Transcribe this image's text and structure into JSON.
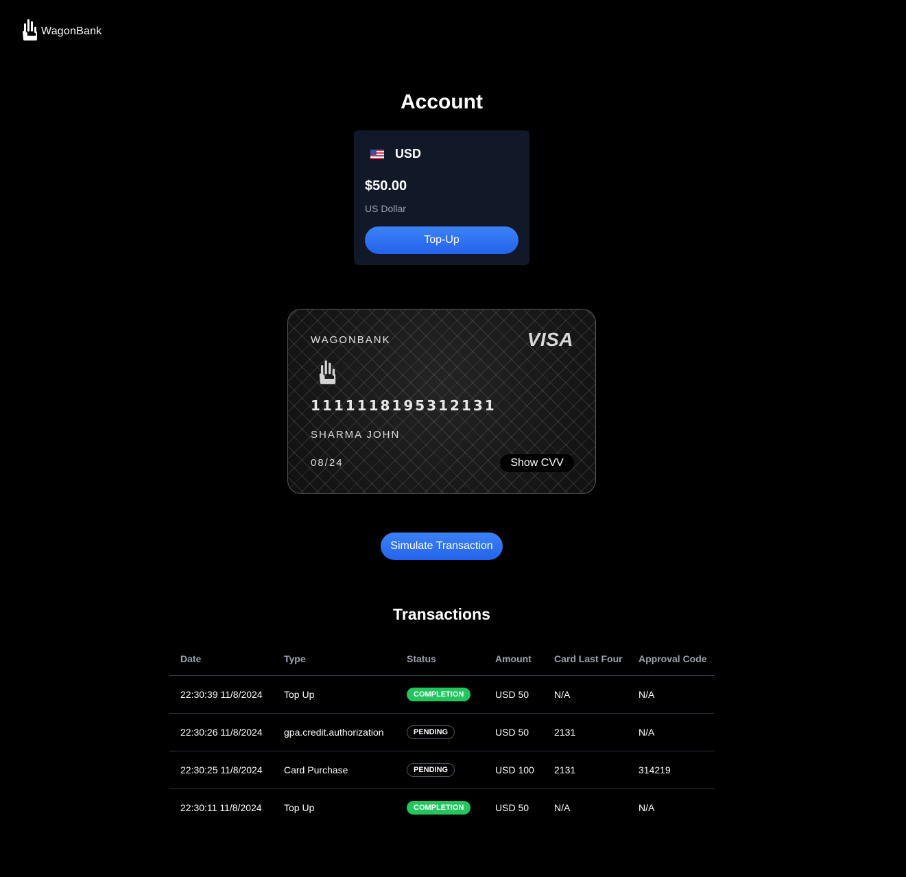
{
  "brand": {
    "name": "WagonBank",
    "logo_icon": "raised-hand-icon"
  },
  "account": {
    "title": "Account",
    "currency_code": "USD",
    "flag_icon": "us-flag-icon",
    "balance": "$50.00",
    "currency_name": "US Dollar",
    "topup_label": "Top-Up"
  },
  "card": {
    "bank_name": "WAGONBANK",
    "network": "VISA",
    "chip_icon": "raised-hand-icon",
    "number": "1111118195312131",
    "holder": "SHARMA JOHN",
    "expiry": "08/24",
    "show_cvv_label": "Show CVV"
  },
  "simulate_label": "Simulate Transaction",
  "transactions": {
    "title": "Transactions",
    "columns": [
      "Date",
      "Type",
      "Status",
      "Amount",
      "Card Last Four",
      "Approval Code"
    ],
    "rows": [
      {
        "date": "22:30:39 11/8/2024",
        "type": "Top Up",
        "status": "COMPLETION",
        "amount": "USD 50",
        "card_last_four": "N/A",
        "approval_code": "N/A"
      },
      {
        "date": "22:30:26 11/8/2024",
        "type": "gpa.credit.authorization",
        "status": "PENDING",
        "amount": "USD 50",
        "card_last_four": "2131",
        "approval_code": "N/A"
      },
      {
        "date": "22:30:25 11/8/2024",
        "type": "Card Purchase",
        "status": "PENDING",
        "amount": "USD 100",
        "card_last_four": "2131",
        "approval_code": "314219"
      },
      {
        "date": "22:30:11 11/8/2024",
        "type": "Top Up",
        "status": "COMPLETION",
        "amount": "USD 50",
        "card_last_four": "N/A",
        "approval_code": "N/A"
      }
    ]
  },
  "colors": {
    "background": "#000000",
    "panel": "#111827",
    "accent": "#3b82f6",
    "completion": "#22c55e",
    "muted_text": "#9ca3af"
  }
}
